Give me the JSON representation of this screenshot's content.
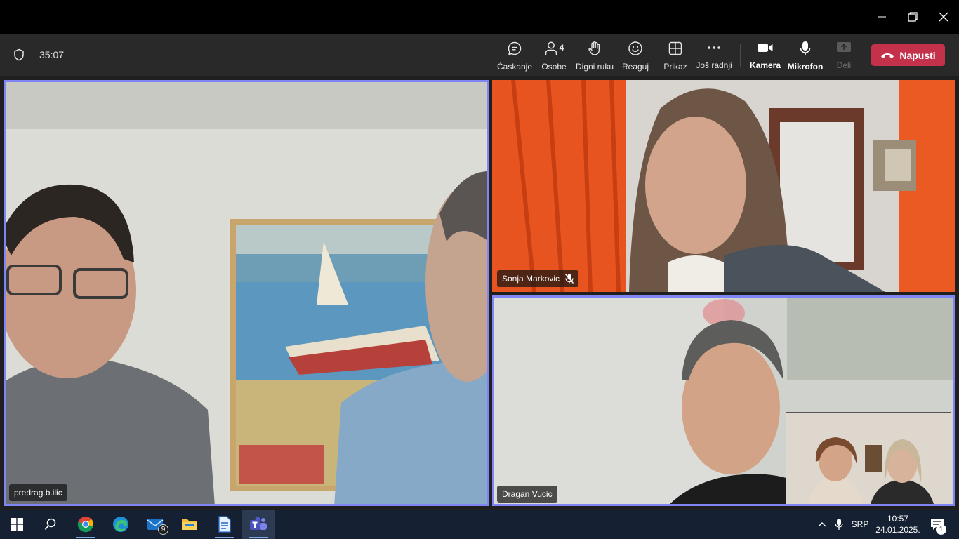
{
  "meeting": {
    "timer": "35:07",
    "toolbar": {
      "chat_label": "Ćaskanje",
      "people_label": "Osobe",
      "people_count": "4",
      "raise_hand_label": "Digni ruku",
      "react_label": "Reaguj",
      "view_label": "Prikaz",
      "more_label": "Još radnji",
      "camera_label": "Kamera",
      "mic_label": "Mikrofon",
      "share_label": "Deli",
      "leave_label": "Napusti"
    },
    "participants": [
      {
        "name": "predrag.b.ilic",
        "muted": false,
        "active_speaker": true
      },
      {
        "name": "Sonja Markovic",
        "muted": true,
        "active_speaker": false
      },
      {
        "name": "Dragan Vucic",
        "muted": false,
        "active_speaker": true
      }
    ],
    "colors": {
      "accent": "#7f85f5",
      "leave": "#c4314b"
    }
  },
  "taskbar": {
    "apps": [
      {
        "icon": "windows-start-icon"
      },
      {
        "icon": "search-icon"
      },
      {
        "icon": "chrome-icon"
      },
      {
        "icon": "edge-icon"
      },
      {
        "icon": "mail-icon",
        "badge": "9"
      },
      {
        "icon": "file-explorer-icon"
      },
      {
        "icon": "document-app-icon"
      },
      {
        "icon": "teams-icon"
      }
    ],
    "tray": {
      "language": "SRP",
      "time": "10:57",
      "date": "24.01.2025.",
      "notifications": "1"
    }
  }
}
